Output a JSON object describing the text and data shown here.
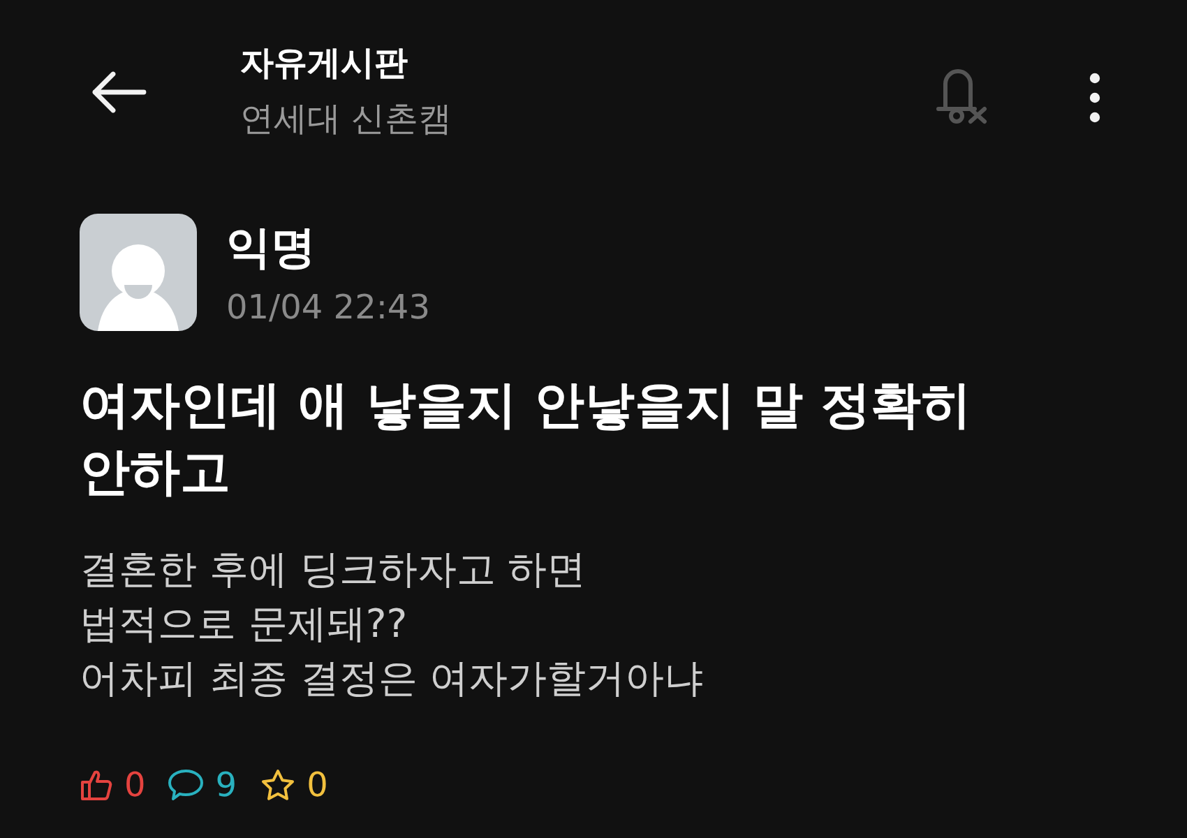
{
  "header": {
    "title": "자유게시판",
    "subtitle": "연세대 신촌캠",
    "notifications_on": false
  },
  "post": {
    "author": "익명",
    "time": "01/04 22:43",
    "title": "여자인데 애 낳을지 안낳을지 말 정확히 안하고",
    "body": "결혼한 후에 딩크하자고 하면\n법적으로 문제돼??\n어차피 최종 결정은 여자가할거아냐"
  },
  "counts": [
    {
      "kind": "like",
      "value": "0",
      "color": "#e5433f"
    },
    {
      "kind": "comment",
      "value": "9",
      "color": "#29b1bf"
    },
    {
      "kind": "scrap",
      "value": "0",
      "color": "#f2c03e"
    }
  ]
}
